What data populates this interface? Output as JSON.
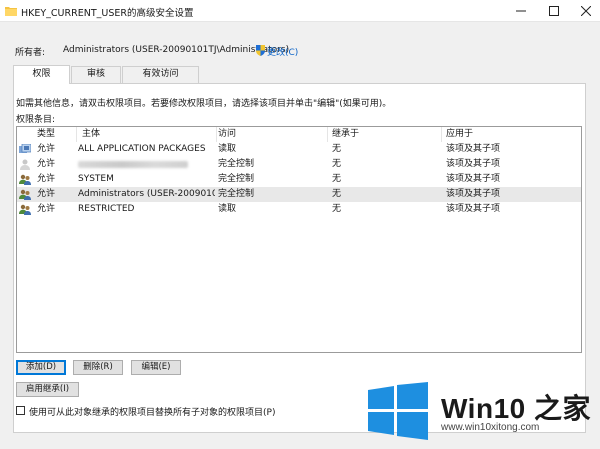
{
  "window": {
    "title": "HKEY_CURRENT_USER的高级安全设置",
    "folder_icon": "folder-icon",
    "minimize": "—",
    "maximize": "☐",
    "close": "✕"
  },
  "owner": {
    "label": "所有者:",
    "value": "Administrators (USER-20090101TJ\\Administrators)",
    "change_link": "更改(C)"
  },
  "tabs": [
    {
      "label": "权限",
      "active": true
    },
    {
      "label": "审核",
      "active": false
    },
    {
      "label": "有效访问",
      "active": false
    }
  ],
  "info_text": "如需其他信息，请双击权限项目。若要修改权限项目，请选择该项目并单击\"编辑\"(如果可用)。",
  "entries_label": "权限条目:",
  "columns": {
    "type": "类型",
    "principal": "主体",
    "access": "访问",
    "inherited_from": "继承于",
    "applies_to": "应用于"
  },
  "rows": [
    {
      "icon": "package-group-icon",
      "type": "允许",
      "principal": "ALL APPLICATION PACKAGES",
      "access": "读取",
      "inherited_from": "无",
      "applies_to": "该项及其子项"
    },
    {
      "icon": "user-icon",
      "type": "允许",
      "principal": "",
      "access": "完全控制",
      "inherited_from": "无",
      "applies_to": "该项及其子项"
    },
    {
      "icon": "users-group-icon",
      "type": "允许",
      "principal": "SYSTEM",
      "access": "完全控制",
      "inherited_from": "无",
      "applies_to": "该项及其子项"
    },
    {
      "icon": "users-group-icon",
      "type": "允许",
      "principal": "Administrators (USER-20090101...",
      "access": "完全控制",
      "inherited_from": "无",
      "applies_to": "该项及其子项"
    },
    {
      "icon": "users-group-icon",
      "type": "允许",
      "principal": "RESTRICTED",
      "access": "读取",
      "inherited_from": "无",
      "applies_to": "该项及其子项"
    }
  ],
  "buttons": {
    "add": "添加(D)",
    "remove": "删除(R)",
    "edit": "编辑(E)",
    "enable_inheritance": "启用继承(I)"
  },
  "replace_checkbox": {
    "label": "使用可从此对象继承的权限项目替换所有子对象的权限项目(P)",
    "checked": false
  },
  "watermark": {
    "brand": "Win10 之家",
    "url": "www.win10xitong.com"
  },
  "colors": {
    "link": "#0b63c7",
    "accent": "#0078d7",
    "selected_row": "#e8e8e8"
  }
}
